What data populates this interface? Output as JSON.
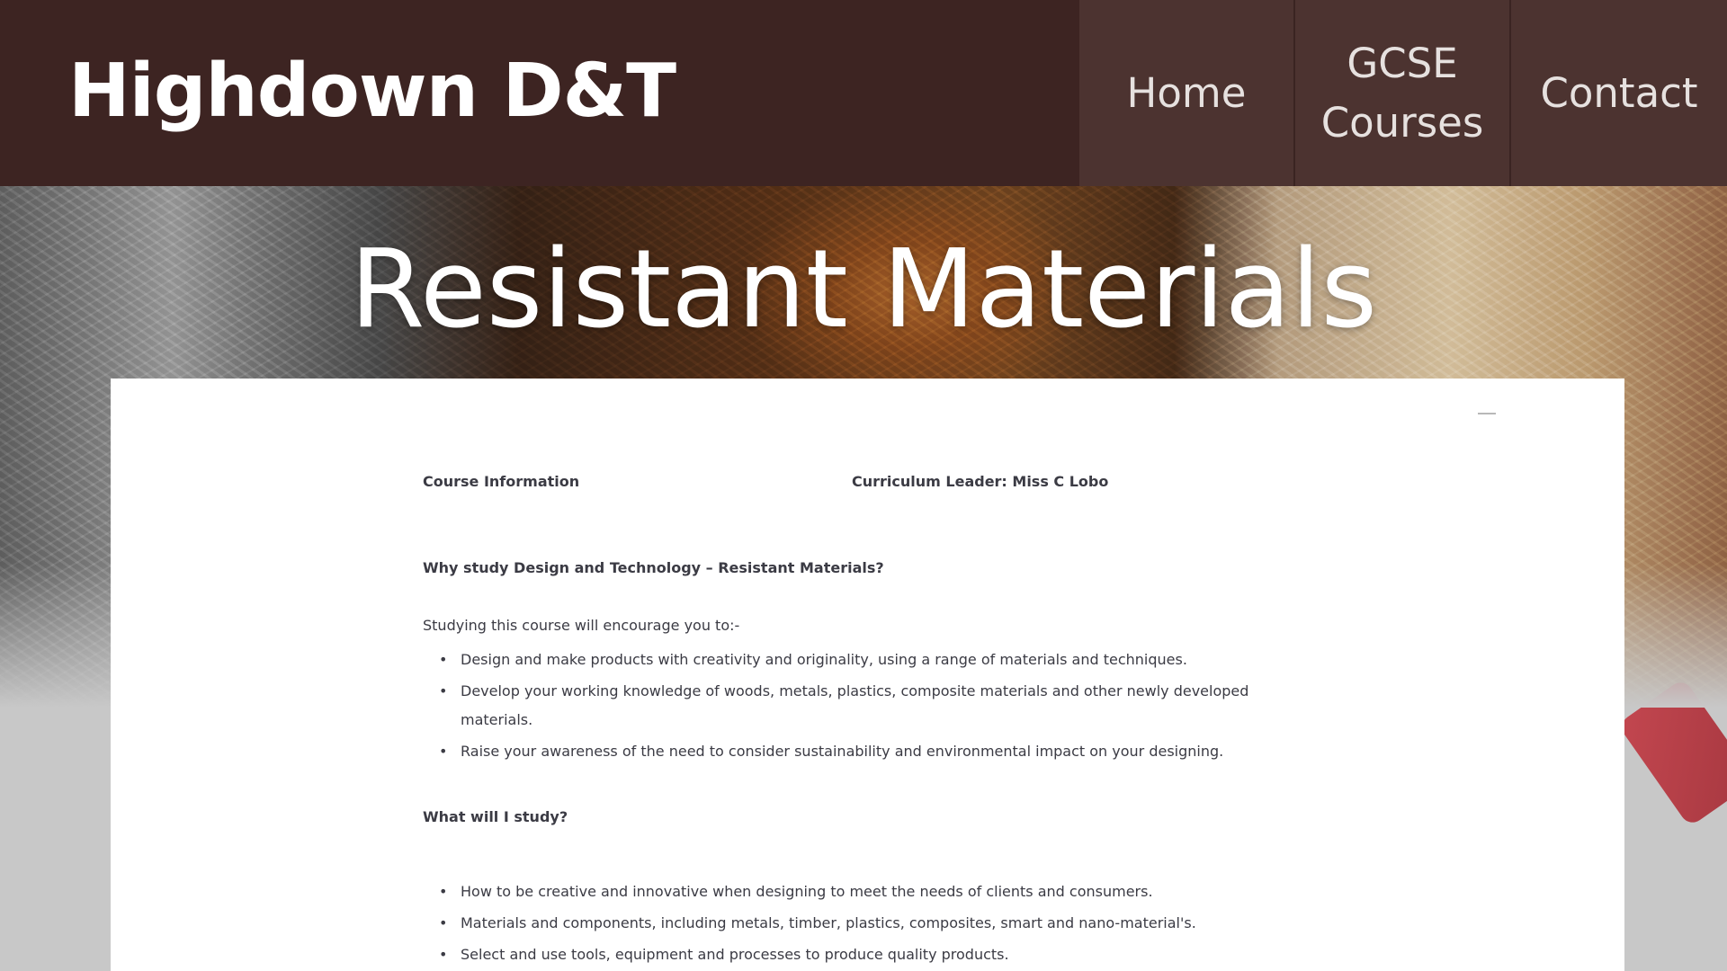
{
  "header": {
    "site_title": "Highdown D&T",
    "nav": {
      "home": "Home",
      "gcse_line1": "GCSE",
      "gcse_line2": "Courses",
      "contact": "Contact"
    }
  },
  "hero": {
    "page_title": "Resistant Materials"
  },
  "content": {
    "course_information": "Course Information",
    "curriculum_leader": "Curriculum Leader: Miss C Lobo",
    "why_heading": "Why study Design and Technology – Resistant Materials?",
    "intro": "Studying this course will encourage you to:-",
    "why_points": [
      "Design and make products with creativity and originality, using a range of materials and techniques.",
      "Develop your working knowledge of woods, metals, plastics, composite materials and other newly developed materials.",
      "Raise your awareness of the need to consider sustainability and environmental impact on your designing."
    ],
    "what_heading": "What will I study?",
    "what_points": [
      "How to be creative and innovative when designing to meet the needs of clients and consumers.",
      "Materials and components, including metals, timber, plastics, composites, smart and nano-material's.",
      "Select and use tools, equipment and processes to produce quality products."
    ]
  }
}
